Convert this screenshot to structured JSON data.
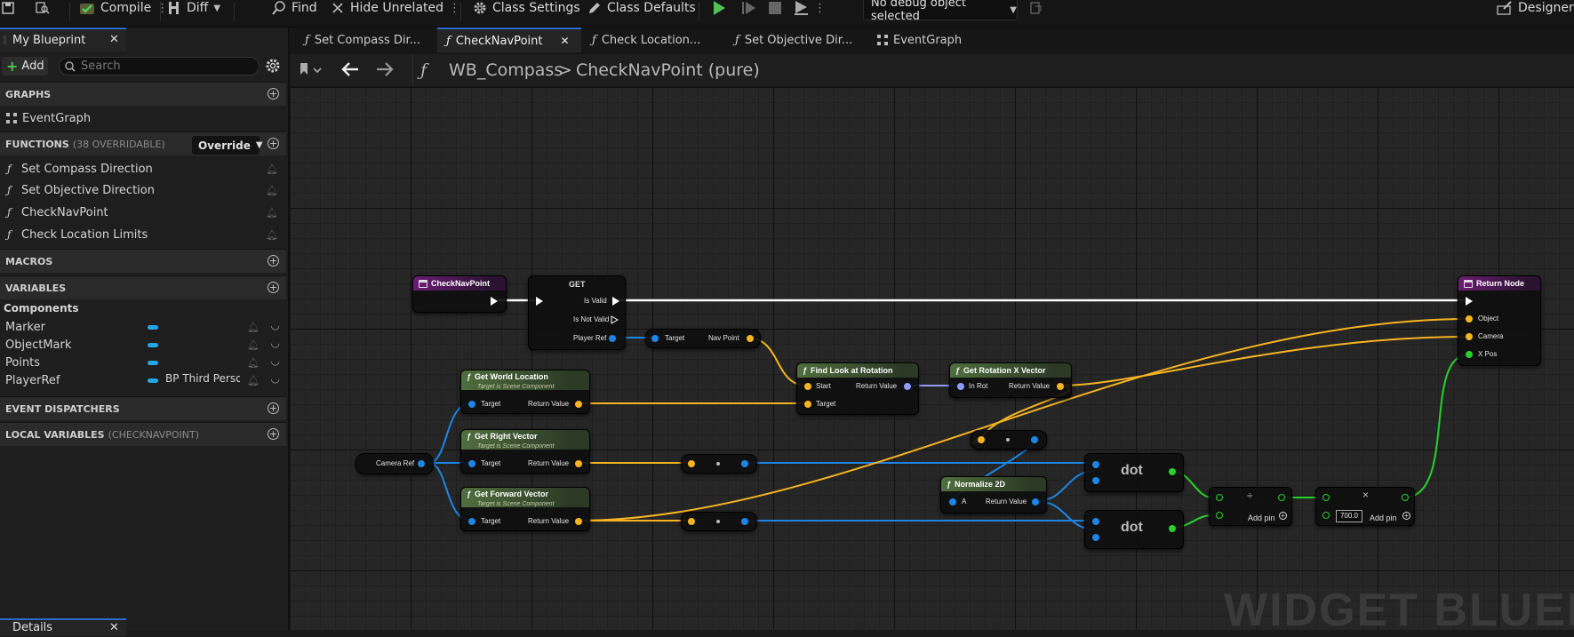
{
  "toolbar": {
    "compile": "Compile",
    "diff": "Diff",
    "find": "Find",
    "hide_unrelated": "Hide Unrelated",
    "class_settings": "Class Settings",
    "class_defaults": "Class Defaults",
    "debug_object": "No debug object selected",
    "designer": "Designer"
  },
  "left_panel": {
    "tab_title": "My Blueprint",
    "add_label": "Add",
    "search_placeholder": "Search",
    "graphs": {
      "header": "GRAPHS",
      "items": [
        "EventGraph"
      ]
    },
    "functions": {
      "header": "FUNCTIONS",
      "overridable": "(38 OVERRIDABLE)",
      "override_label": "Override",
      "items": [
        "Set Compass Direction",
        "Set Objective Direction",
        "CheckNavPoint",
        "Check Location Limits"
      ]
    },
    "macros": {
      "header": "MACROS"
    },
    "variables": {
      "header": "VARIABLES",
      "category": "Components",
      "items": [
        {
          "name": "Marker",
          "type": ""
        },
        {
          "name": "ObjectMark",
          "type": ""
        },
        {
          "name": "Points",
          "type": ""
        },
        {
          "name": "PlayerRef",
          "type": "BP Third Perso"
        }
      ]
    },
    "event_dispatchers": {
      "header": "EVENT DISPATCHERS"
    },
    "local_variables": {
      "header": "LOCAL VARIABLES",
      "sub": "(CHECKNAVPOINT)"
    },
    "details_tab": "Details"
  },
  "doc_tabs": [
    {
      "label": "Set Compass Dir..."
    },
    {
      "label": "CheckNavPoint"
    },
    {
      "label": "Check Location..."
    },
    {
      "label": "Set Objective Dir..."
    },
    {
      "label": "EventGraph"
    }
  ],
  "breadcrumb": {
    "blueprint": "WB_Compass",
    "function": "CheckNavPoint (pure)"
  },
  "watermark": "WIDGET BLUEP",
  "nodes": {
    "entry": {
      "title": "CheckNavPoint"
    },
    "get": {
      "title": "GET",
      "is_valid": "Is Valid",
      "is_not_valid": "Is Not Valid",
      "player_ref": "Player Ref"
    },
    "nav": {
      "target": "Target",
      "nav_point": "Nav Point"
    },
    "find_look": {
      "title": "Find Look at Rotation",
      "start": "Start",
      "target": "Target",
      "return_value": "Return Value"
    },
    "get_rot_x": {
      "title": "Get Rotation X Vector",
      "in_rot": "In Rot",
      "return_value": "Return Value"
    },
    "get_world_loc": {
      "title": "Get World Location",
      "sub": "Target is Scene Component",
      "target": "Target",
      "return_value": "Return Value"
    },
    "get_right": {
      "title": "Get Right Vector",
      "sub": "Target is Scene Component",
      "target": "Target",
      "return_value": "Return Value"
    },
    "get_forward": {
      "title": "Get Forward Vector",
      "sub": "Target is Scene Component",
      "target": "Target",
      "return_value": "Return Value"
    },
    "camera_ref": {
      "label": "Camera Ref"
    },
    "normalize": {
      "title": "Normalize 2D",
      "a": "A",
      "return_value": "Return Value"
    },
    "dot1": {
      "title": "dot"
    },
    "dot2": {
      "title": "dot"
    },
    "divide": {
      "symbol": "÷",
      "add_pin": "Add pin"
    },
    "multiply": {
      "symbol": "×",
      "value": "700.0",
      "add_pin": "Add pin"
    },
    "return_node": {
      "title": "Return Node",
      "object": "Object",
      "camera": "Camera",
      "x_pos": "X Pos"
    }
  }
}
